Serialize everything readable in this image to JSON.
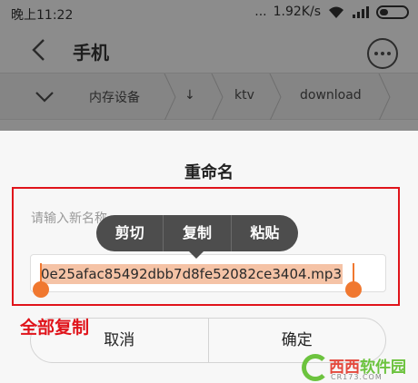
{
  "status_bar": {
    "time": "晚上11:22",
    "dots": "...",
    "speed": "1.92K/s"
  },
  "header": {
    "title": "手机"
  },
  "breadcrumb": {
    "items": [
      "内存设备",
      "↓",
      "ktv",
      "download"
    ]
  },
  "dialog": {
    "title": "重命名",
    "hint": "请输入新名称",
    "filename": "0e25afac85492dbb7d8fe52082ce3404.mp3",
    "context_menu": [
      "剪切",
      "复制",
      "粘贴"
    ],
    "cancel_label": "取消",
    "confirm_label": "确定"
  },
  "annotation": {
    "text": "全部复制"
  },
  "watermark": {
    "name_part1": "西西",
    "name_part2": "软件园",
    "url": "CR173.COM"
  },
  "colors": {
    "accent_handle": "#f07830",
    "annotation_red": "#e0141b",
    "selection": "#f5c3a6"
  },
  "icons": [
    "wifi-icon",
    "signal-icon",
    "battery-icon",
    "back-icon",
    "more-icon",
    "chevron-down-icon"
  ]
}
